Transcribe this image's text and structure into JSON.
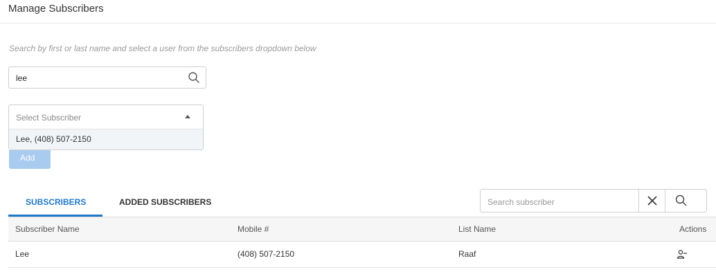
{
  "header": {
    "title": "Manage Subscribers"
  },
  "helper_text": "Search by first or last name and select a user from the subscribers dropdown below",
  "user_search": {
    "value": "lee"
  },
  "subscriber_select": {
    "placeholder": "Select Subscriber",
    "options": [
      "Lee, (408) 507-2150"
    ]
  },
  "add_button": {
    "label": "Add"
  },
  "tabs": [
    {
      "label": "SUBSCRIBERS",
      "active": true
    },
    {
      "label": "ADDED SUBSCRIBERS",
      "active": false
    }
  ],
  "table_search": {
    "placeholder": "Search subscriber"
  },
  "table": {
    "columns": [
      "Subscriber Name",
      "Mobile #",
      "List Name",
      "Actions"
    ],
    "rows": [
      {
        "name": "Lee",
        "mobile": "(408) 507-2150",
        "list": "Raaf"
      }
    ]
  },
  "colors": {
    "accent": "#1f78c8",
    "disabled_button": "#a9cbf0"
  },
  "icons": {
    "search": "search-icon",
    "clear": "close-icon",
    "caret": "caret-up-icon",
    "action": "remove-user-icon"
  }
}
